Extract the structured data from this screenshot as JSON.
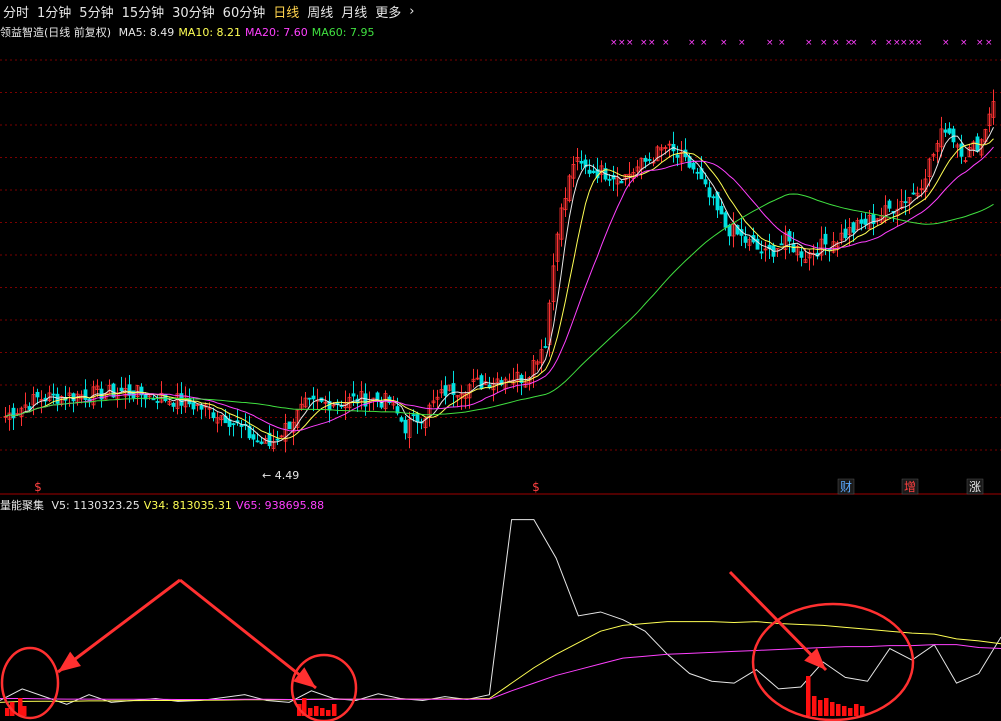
{
  "tabs": [
    "分时",
    "1分钟",
    "5分钟",
    "15分钟",
    "30分钟",
    "60分钟",
    "日线",
    "周线",
    "月线",
    "更多",
    "›"
  ],
  "active_tab": "日线",
  "stock_title": "领益智造(日线 前复权)",
  "ma": [
    {
      "label": "MA5: 8.49",
      "color": "#e6e6e6"
    },
    {
      "label": "MA10: 8.21",
      "color": "#ffff54"
    },
    {
      "label": "MA20: 7.60",
      "color": "#ff40ff"
    },
    {
      "label": "MA60: 7.95",
      "color": "#40e040"
    }
  ],
  "volume_indicator": {
    "name": "量能聚集",
    "values": [
      {
        "label": "V5: 1130323.25",
        "color": "#e6e6e6"
      },
      {
        "label": "V34: 813035.31",
        "color": "#ffff54"
      },
      {
        "label": "V65: 938695.88",
        "color": "#ff40ff"
      }
    ]
  },
  "low_label": "← 4.49",
  "markers": [
    {
      "text": "$",
      "color": "#ff4040"
    },
    {
      "text": "$",
      "color": "#ff4040"
    },
    {
      "text": "财",
      "color": "#5aa9ff"
    },
    {
      "text": "增",
      "color": "#ff4040"
    },
    {
      "text": "涨",
      "color": "#e6e6e6"
    }
  ],
  "signal_mark": "×",
  "colors": {
    "up": "#ff3232",
    "down": "#00e0e0",
    "grid": "#7a0000",
    "arrow": "#ff3030",
    "circle": "#ff3030",
    "vol_bar": "#ff1010"
  },
  "chart_data": {
    "type": "line",
    "title": "领益智造(日线 前复权)",
    "y_range_price": [
      4.2,
      10.2
    ],
    "ma_lines": [
      {
        "name": "MA5",
        "color": "#e6e6e6"
      },
      {
        "name": "MA10",
        "color": "#ffff54"
      },
      {
        "name": "MA20",
        "color": "#ff40ff"
      },
      {
        "name": "MA60",
        "color": "#40e040"
      }
    ],
    "volume_lines": [
      {
        "name": "V5",
        "color": "#e6e6e6",
        "values": [
          60,
          120,
          80,
          40,
          90,
          50,
          60,
          70,
          55,
          60,
          75,
          90,
          60,
          50,
          110,
          70,
          60,
          95,
          70,
          60,
          80,
          65,
          90,
          1000,
          1000,
          800,
          500,
          520,
          480,
          420,
          300,
          200,
          160,
          150,
          220,
          120,
          130,
          260,
          180,
          160,
          330,
          270,
          350,
          150,
          200,
          390
        ]
      },
      {
        "name": "V34",
        "color": "#ffff54",
        "values": [
          50,
          55,
          56,
          55,
          58,
          58,
          59,
          60,
          60,
          61,
          62,
          64,
          64,
          64,
          66,
          66,
          66,
          67,
          67,
          67,
          68,
          68,
          70,
          150,
          230,
          300,
          360,
          420,
          450,
          460,
          470,
          470,
          470,
          465,
          470,
          460,
          455,
          450,
          440,
          430,
          420,
          410,
          405,
          380,
          370,
          355
        ]
      },
      {
        "name": "V65",
        "color": "#ff40ff",
        "values": [
          70,
          70,
          68,
          67,
          67,
          66,
          66,
          66,
          65,
          65,
          65,
          66,
          66,
          65,
          65,
          66,
          66,
          66,
          66,
          66,
          66,
          66,
          66,
          110,
          150,
          190,
          220,
          250,
          280,
          290,
          300,
          305,
          310,
          315,
          320,
          325,
          330,
          335,
          340,
          340,
          345,
          345,
          350,
          350,
          335,
          330
        ]
      }
    ],
    "volume_y_range": [
      0,
      1050
    ]
  }
}
